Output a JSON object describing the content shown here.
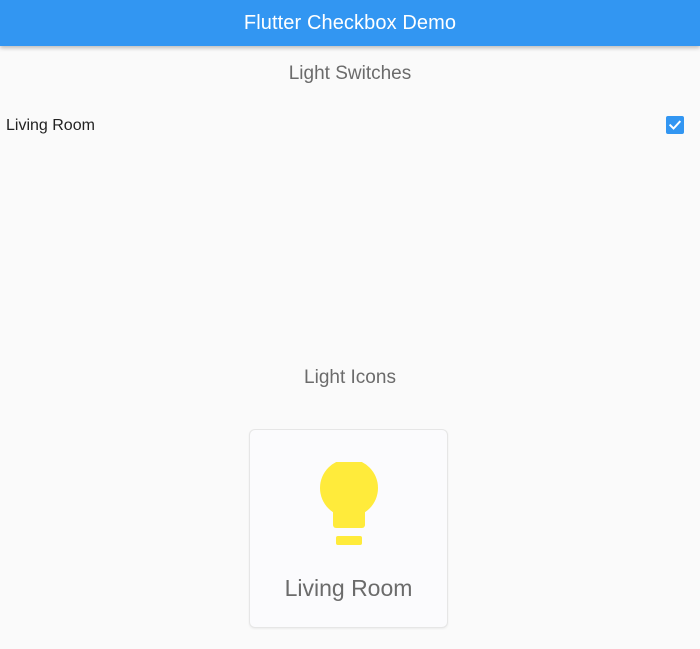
{
  "appbar": {
    "title": "Flutter Checkbox Demo"
  },
  "switches_section": {
    "title": "Light Switches",
    "items": [
      {
        "label": "Living Room",
        "checked": true
      }
    ]
  },
  "icons_section": {
    "title": "Light Icons",
    "cards": [
      {
        "label": "Living Room",
        "icon": "lightbulb-icon",
        "state": "on"
      }
    ]
  },
  "colors": {
    "primary": "#3296f2",
    "bulb_on": "#ffeb3b",
    "background": "#fafafa"
  }
}
